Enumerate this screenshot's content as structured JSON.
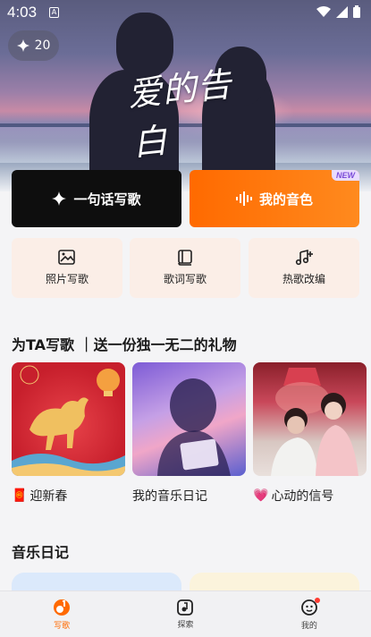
{
  "status_bar": {
    "time": "4:03",
    "notification_glyph": "A"
  },
  "hero": {
    "title": "爱的告白",
    "credits": "20"
  },
  "actions": {
    "lyric_button": "一句话写歌",
    "voice_button": "我的音色",
    "new_badge": "NEW"
  },
  "tools": [
    {
      "label": "照片写歌",
      "icon": "photo-edit-icon"
    },
    {
      "label": "歌词写歌",
      "icon": "lyrics-book-icon"
    },
    {
      "label": "热歌改编",
      "icon": "music-note-add-icon"
    }
  ],
  "gift_section": {
    "title": "为TA写歌 ｜送一份独一无二的礼物",
    "cards": [
      {
        "emoji": "🧧",
        "label": "迎新春"
      },
      {
        "emoji": "",
        "label": "我的音乐日记"
      },
      {
        "emoji": "💗",
        "label": "心动的信号"
      }
    ]
  },
  "diary_section": {
    "title": "音乐日记"
  },
  "bottom_nav": [
    {
      "label": "写歌",
      "icon": "song-write-icon",
      "active": true
    },
    {
      "label": "探索",
      "icon": "explore-icon",
      "active": false
    },
    {
      "label": "我的",
      "icon": "profile-icon",
      "active": false
    }
  ],
  "colors": {
    "accent": "#ff6a00",
    "dark_button": "#0e0e0e",
    "tool_bg": "#fbeee7"
  }
}
